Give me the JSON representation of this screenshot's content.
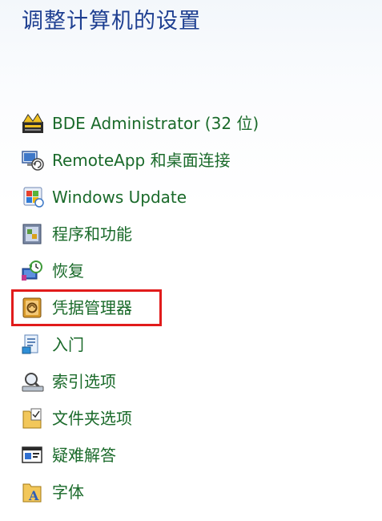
{
  "page": {
    "title": "调整计算机的设置"
  },
  "items": [
    {
      "label": "BDE Administrator (32 位)",
      "icon": "bde-administrator-icon"
    },
    {
      "label": "RemoteApp 和桌面连接",
      "icon": "remote-desktop-icon"
    },
    {
      "label": "Windows Update",
      "icon": "windows-update-icon"
    },
    {
      "label": "程序和功能",
      "icon": "programs-features-icon"
    },
    {
      "label": "恢复",
      "icon": "recovery-icon"
    },
    {
      "label": "凭据管理器",
      "icon": "credential-manager-icon"
    },
    {
      "label": "入门",
      "icon": "getting-started-icon"
    },
    {
      "label": "索引选项",
      "icon": "indexing-options-icon"
    },
    {
      "label": "文件夹选项",
      "icon": "folder-options-icon"
    },
    {
      "label": "疑难解答",
      "icon": "troubleshooting-icon"
    },
    {
      "label": "字体",
      "icon": "fonts-icon"
    }
  ],
  "highlight": {
    "color": "#e11b1b"
  }
}
